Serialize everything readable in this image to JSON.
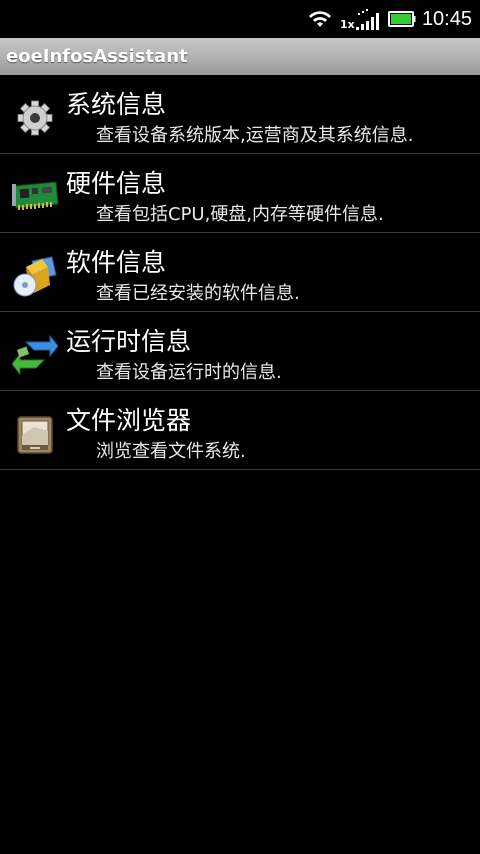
{
  "status_bar": {
    "time": "10:45",
    "network_type": "1x",
    "icons": [
      "wifi-icon",
      "signal-icon",
      "battery-icon"
    ],
    "battery_color": "#33cc33"
  },
  "app": {
    "title": "eoeInfosAssistant"
  },
  "items": [
    {
      "title": "系统信息",
      "desc": "查看设备系统版本,运营商及其系统信息.",
      "icon": "gear-icon"
    },
    {
      "title": "硬件信息",
      "desc": "查看包括CPU,硬盘,内存等硬件信息.",
      "icon": "circuit-board-icon"
    },
    {
      "title": "软件信息",
      "desc": "查看已经安装的软件信息.",
      "icon": "software-package-icon"
    },
    {
      "title": "运行时信息",
      "desc": "查看设备运行时的信息.",
      "icon": "sync-arrows-icon"
    },
    {
      "title": "文件浏览器",
      "desc": "浏览查看文件系统.",
      "icon": "file-cabinet-icon"
    }
  ]
}
